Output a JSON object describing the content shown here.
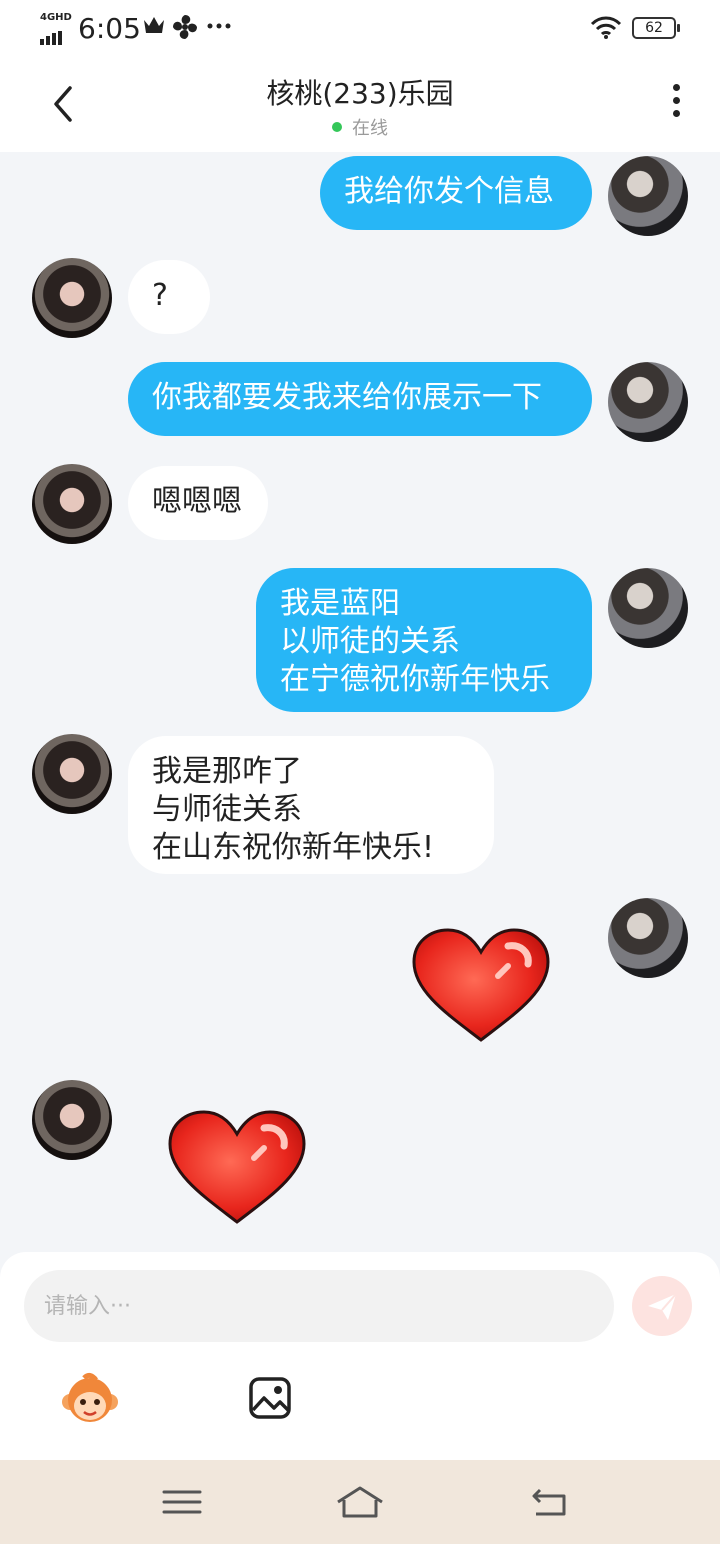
{
  "status_bar": {
    "network": "4GHD",
    "time": "6:05",
    "battery": "62"
  },
  "header": {
    "title": "核桃(233)乐园",
    "status": "在线"
  },
  "messages": [
    {
      "sender": "me",
      "type": "text",
      "text": "我给你发个信息"
    },
    {
      "sender": "other",
      "type": "text",
      "text": "?"
    },
    {
      "sender": "me",
      "type": "text",
      "text": "你我都要发我来给你展示一下"
    },
    {
      "sender": "other",
      "type": "text",
      "text": "嗯嗯嗯"
    },
    {
      "sender": "me",
      "type": "text",
      "text": "我是蓝阳\n以师徒的关系\n在宁德祝你新年快乐"
    },
    {
      "sender": "other",
      "type": "text",
      "text": "我是那咋了\n与师徒关系\n在山东祝你新年快乐!"
    },
    {
      "sender": "me",
      "type": "sticker",
      "sticker": "heart-icon"
    },
    {
      "sender": "other",
      "type": "sticker",
      "sticker": "heart-icon"
    }
  ],
  "input": {
    "placeholder": "请输入···"
  },
  "colors": {
    "my_bubble": "#27b6f6",
    "other_bubble": "#ffffff",
    "background": "#f3f5f8",
    "online": "#34c759",
    "send_button": "#fde3e0",
    "nav_bar": "#f1e7dc"
  }
}
